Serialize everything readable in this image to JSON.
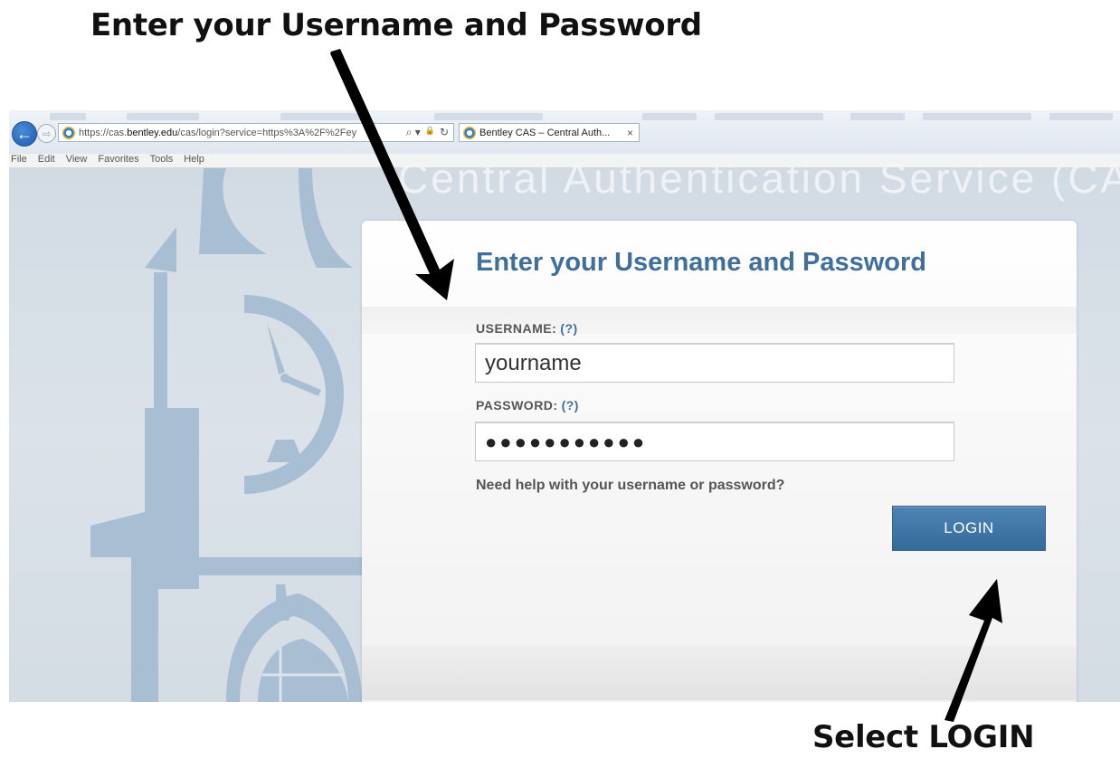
{
  "captions": {
    "top": "Enter your Username and Password",
    "bottom": "Select LOGIN"
  },
  "browser": {
    "url_prefix": "https://cas.",
    "url_domain": "bentley.edu",
    "url_rest": "/cas/login?service=https%3A%2F%2Fey",
    "tab_title": "Bentley CAS – Central Auth...",
    "tab_close": "×",
    "back_glyph": "←",
    "forward_glyph": "⇨",
    "search_glyph": "⌕ ▾",
    "lock_glyph": "🔒",
    "refresh_glyph": "↻",
    "menu": [
      "File",
      "Edit",
      "View",
      "Favorites",
      "Tools",
      "Help"
    ]
  },
  "page": {
    "banner_text": "Central Authentication Service (CAS)",
    "heading": "Enter your Username and Password",
    "username_label": "USERNAME:",
    "username_help": "(?)",
    "username_value": "yourname",
    "password_label": "PASSWORD:",
    "password_help": "(?)",
    "password_value": "●●●●●●●●●●●",
    "help_text": "Need help with your username or password?",
    "login_button": "LOGIN"
  },
  "colors": {
    "accent": "#3f6f9a",
    "button": "#3f76a6",
    "background": "#d8dfe6"
  },
  "icons": [
    "back-arrow-icon",
    "forward-arrow-icon",
    "ie-logo-icon",
    "search-icon",
    "lock-icon",
    "refresh-icon",
    "close-icon",
    "clock-tower-watermark"
  ]
}
